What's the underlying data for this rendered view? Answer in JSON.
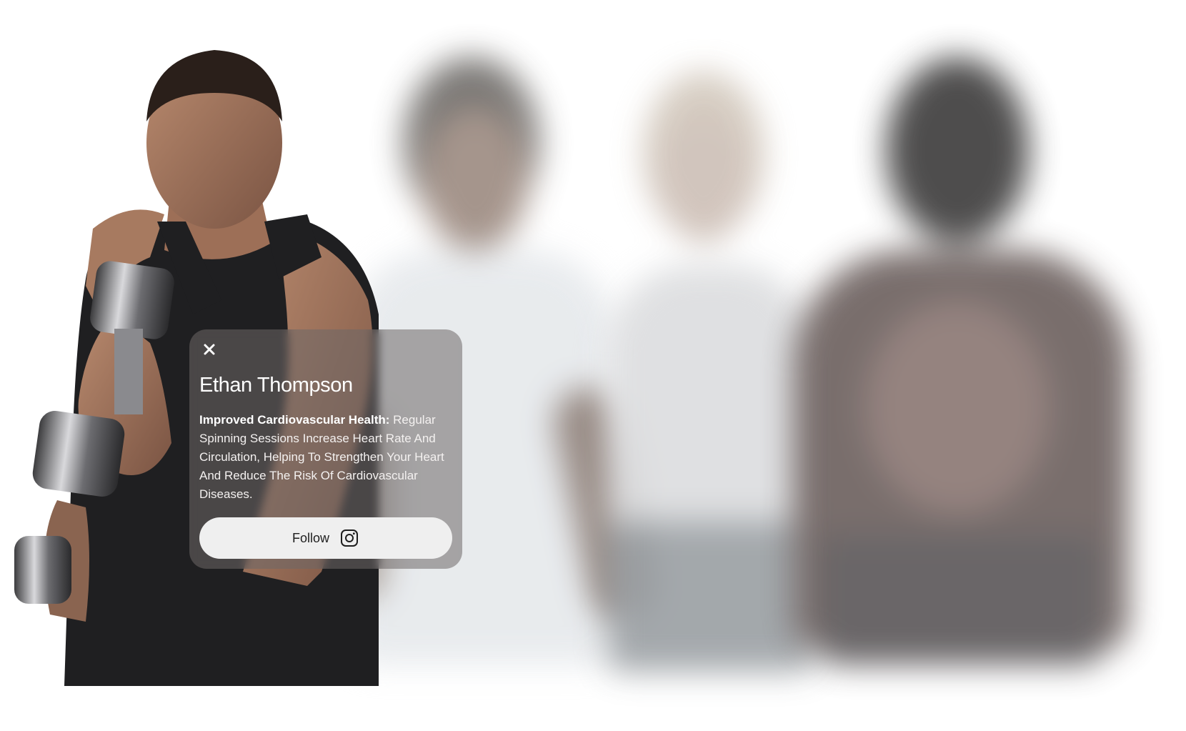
{
  "profile_card": {
    "name": "Ethan Thompson",
    "description_title": "Improved Cardiovascular Health:",
    "description_body": " Regular Spinning Sessions Increase Heart Rate And Circulation, Helping To Strengthen Your Heart And Reduce The Risk Of Cardiovascular Diseases.",
    "follow_label": "Follow",
    "close_icon": "close-icon",
    "social_icon": "instagram-icon"
  },
  "colors": {
    "card_background": "#6e6868",
    "button_background": "#efefef",
    "button_text": "#1e1e1e",
    "text": "#ffffff"
  }
}
